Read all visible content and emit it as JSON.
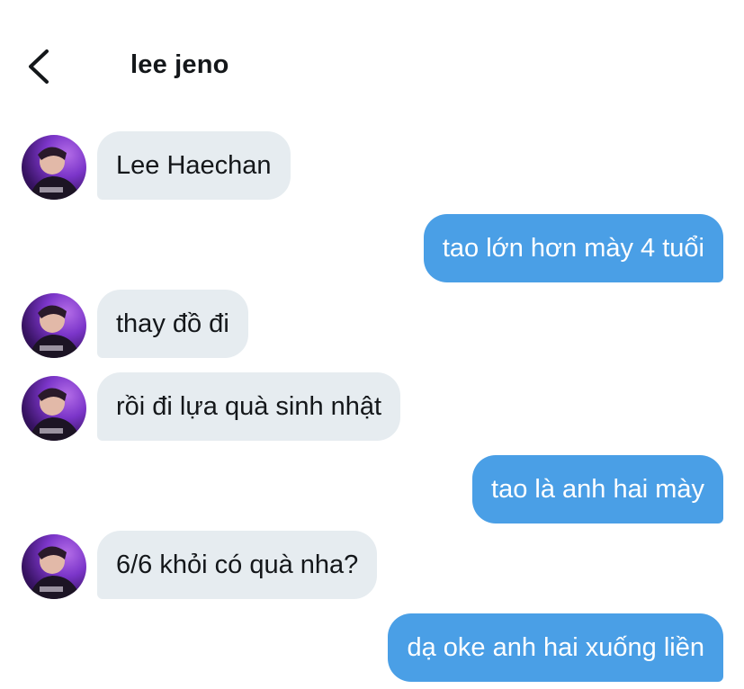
{
  "header": {
    "title": "lee jeno",
    "back_icon": "chevron-left-icon"
  },
  "colors": {
    "incoming_bubble": "#e6ecf0",
    "outgoing_bubble": "#4a9fe6",
    "outgoing_text": "#ffffff",
    "incoming_text": "#14171a"
  },
  "messages": [
    {
      "direction": "incoming",
      "text": "Lee Haechan"
    },
    {
      "direction": "outgoing",
      "text": "tao lớn hơn mày 4 tuổi"
    },
    {
      "direction": "incoming",
      "text": "thay đồ đi"
    },
    {
      "direction": "incoming",
      "text": "rồi đi lựa quà sinh nhật"
    },
    {
      "direction": "outgoing",
      "text": "tao là anh hai mày"
    },
    {
      "direction": "incoming",
      "text": "6/6 khỏi có quà nha?"
    },
    {
      "direction": "outgoing",
      "text": "dạ oke anh hai xuống liền"
    }
  ]
}
